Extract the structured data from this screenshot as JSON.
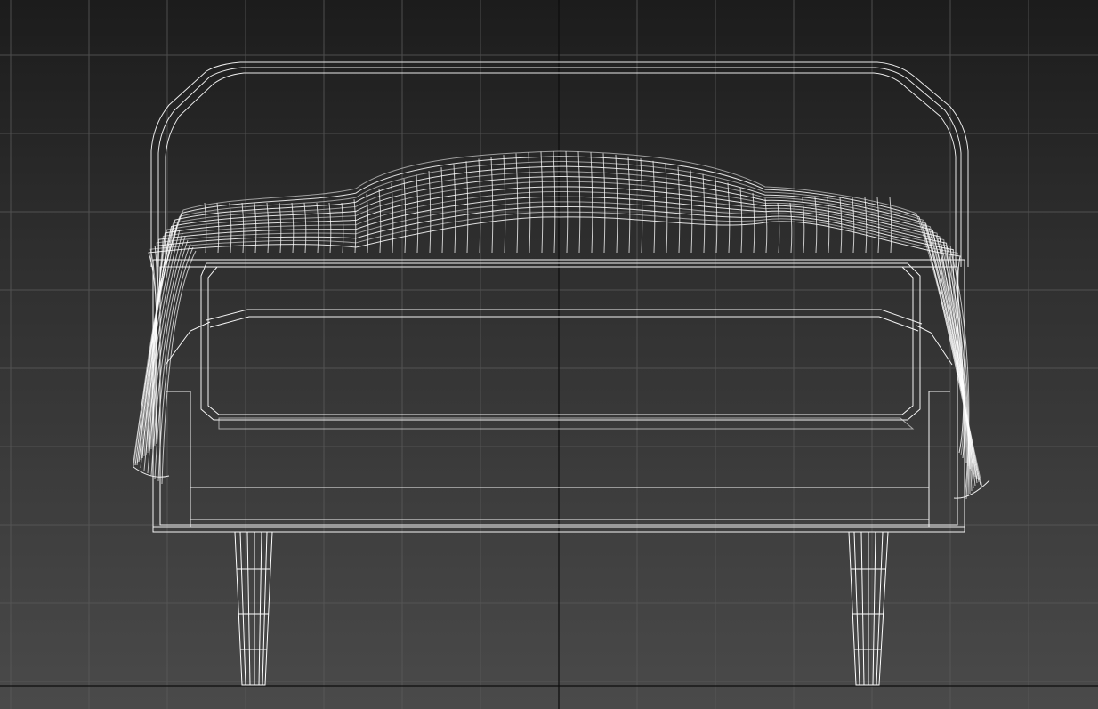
{
  "viewport": {
    "name": "",
    "view": "front",
    "render_mode": "wireframe",
    "background_top": "#1c1c1c",
    "background_bottom": "#4a4a4a",
    "grid_color": "#5a5a5a",
    "axis_color": "#0a0a0a",
    "wire_color": "#ffffff",
    "grid_visible": true
  },
  "scene": {
    "object": "bed",
    "parts": [
      "headboard",
      "duvet",
      "bed-frame",
      "left-leg",
      "right-leg"
    ]
  }
}
